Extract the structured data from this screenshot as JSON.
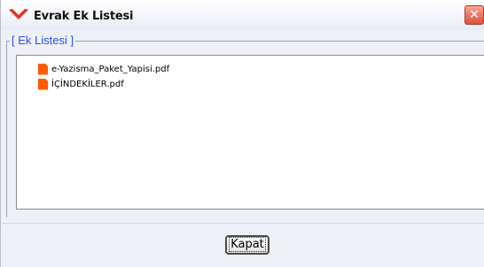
{
  "window": {
    "title": "Evrak Ek Listesi",
    "close_glyph": "✕"
  },
  "group": {
    "legend": "[ Ek Listesi ]"
  },
  "files": [
    {
      "name": "e-Yazisma_Paket_Yapisi.pdf",
      "icon": "pdf-file-icon"
    },
    {
      "name": "İÇİNDEKİLER.pdf",
      "icon": "pdf-file-icon"
    }
  ],
  "footer": {
    "close_label": "Kapat"
  },
  "colors": {
    "legend": "#2c4ef0",
    "file_icon": "#ff5a00",
    "close_button_red": "#d9513c"
  }
}
